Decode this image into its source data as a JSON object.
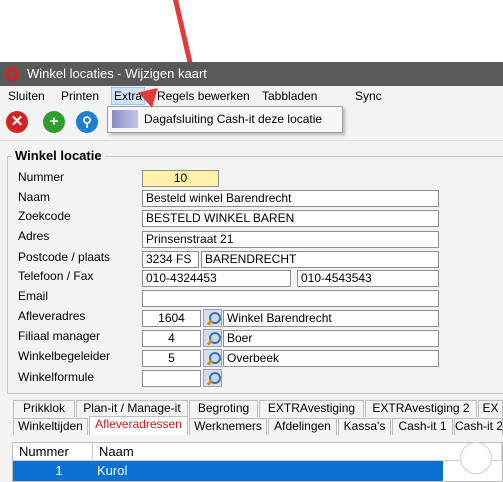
{
  "window": {
    "title": "Winkel locaties - Wijzigen kaart"
  },
  "menu": {
    "sluiten": "Sluiten",
    "printen": "Printen",
    "extra": "Extra",
    "regels": "Regels bewerken",
    "tabbladen": "Tabbladen",
    "sync": "Sync"
  },
  "dropdown": {
    "item": "Dagafsluiting Cash-it deze locatie"
  },
  "toolbar": {
    "close_icon": "close-icon",
    "add_icon": "add-icon",
    "search_icon": "search-icon"
  },
  "form": {
    "group_title": "Winkel locatie",
    "labels": {
      "nummer": "Nummer",
      "naam": "Naam",
      "zoekcode": "Zoekcode",
      "adres": "Adres",
      "postcode": "Postcode / plaats",
      "telefoon": "Telefoon / Fax",
      "email": "Email",
      "afleveradres": "Afleveradres",
      "filiaal": "Filiaal manager",
      "begeleider": "Winkelbegeleider",
      "formule": "Winkelformule"
    },
    "values": {
      "nummer": "10",
      "naam": "Besteld winkel Barendrecht",
      "zoekcode": "BESTELD WINKEL BAREN",
      "adres": "Prinsenstraat 21",
      "postcode": "3234 FS",
      "plaats": "BARENDRECHT",
      "telefoon": "010-4324453",
      "fax": "010-4543543",
      "email": "",
      "afleveradres_code": "1604",
      "afleveradres_naam": "Winkel Barendrecht",
      "filiaal_code": "4",
      "filiaal_naam": "Boer",
      "begeleider_code": "5",
      "begeleider_naam": "Overbeek",
      "formule_code": ""
    }
  },
  "tabs_row1": [
    "Prikklok",
    "Plan-it / Manage-it",
    "Begroting",
    "EXTRAvestiging",
    "EXTRAvestiging 2",
    "EX"
  ],
  "tabs_row2": [
    "Winkeltijden",
    "Afleveradressen",
    "Werknemers",
    "Afdelingen",
    "Kassa's",
    "Cash-it 1",
    "Cash-it 2"
  ],
  "grid": {
    "headers": [
      "Nummer",
      "Naam"
    ],
    "rows": [
      {
        "nummer": "1",
        "naam": "Kurol"
      }
    ]
  }
}
